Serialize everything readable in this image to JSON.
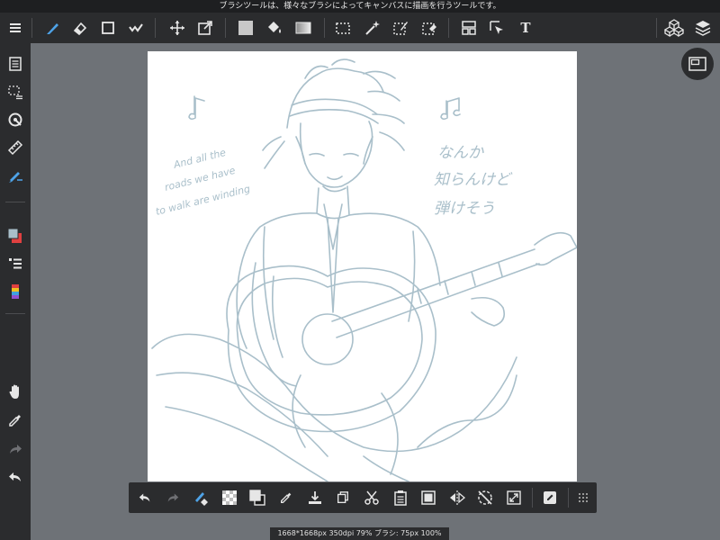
{
  "status_bar": {
    "hint": "ブラシツールは、様々なブラシによってキャンバスに描画を行うツールです。"
  },
  "toolbar": {
    "text_tool_glyph": "T",
    "icons": [
      "menu-icon",
      "brush-icon",
      "eraser-icon",
      "shape-icon",
      "fill-icon",
      "move-icon",
      "transform-icon",
      "fill-color-icon",
      "bucket-icon",
      "gradient-icon",
      "select-rect-icon",
      "magic-wand-icon",
      "select-pen-icon",
      "select-eraser-icon",
      "frame-icon",
      "operation-icon",
      "text-icon",
      "material-icon",
      "layers-icon"
    ]
  },
  "left_toolbar": {
    "icons": [
      "page-manager-icon",
      "selection-panel-icon",
      "snap-icon",
      "ruler-icon",
      "brush-panel-icon",
      "color-panel-icon",
      "brush-list-icon",
      "color-palette-icon",
      "hand-icon",
      "eyedropper-icon",
      "redo-icon",
      "undo-icon"
    ]
  },
  "canvas": {
    "colors": {
      "sketch": "#a9bfca",
      "background": "#ffffff"
    },
    "lyrics_en": [
      "And all the",
      "roads we have",
      "to walk are winding"
    ],
    "lyrics_ja": [
      "なんか",
      "知らんけど",
      "弾けそう"
    ],
    "music_notes": [
      "♪",
      "♫"
    ]
  },
  "bottom_toolbar": {
    "icons": [
      "undo-icon",
      "redo-icon",
      "clear-brush-icon",
      "transparent-icon",
      "swap-color-icon",
      "eyedropper-icon",
      "save-icon",
      "copy-icon",
      "cut-icon",
      "paste-icon",
      "fill-selection-icon",
      "flip-icon",
      "rotate-icon",
      "zoom-fit-icon",
      "edit-icon",
      "grid-dots-icon"
    ]
  },
  "info": {
    "text": "1668*1668px 350dpi 79% ブラシ: 75px 100%"
  }
}
